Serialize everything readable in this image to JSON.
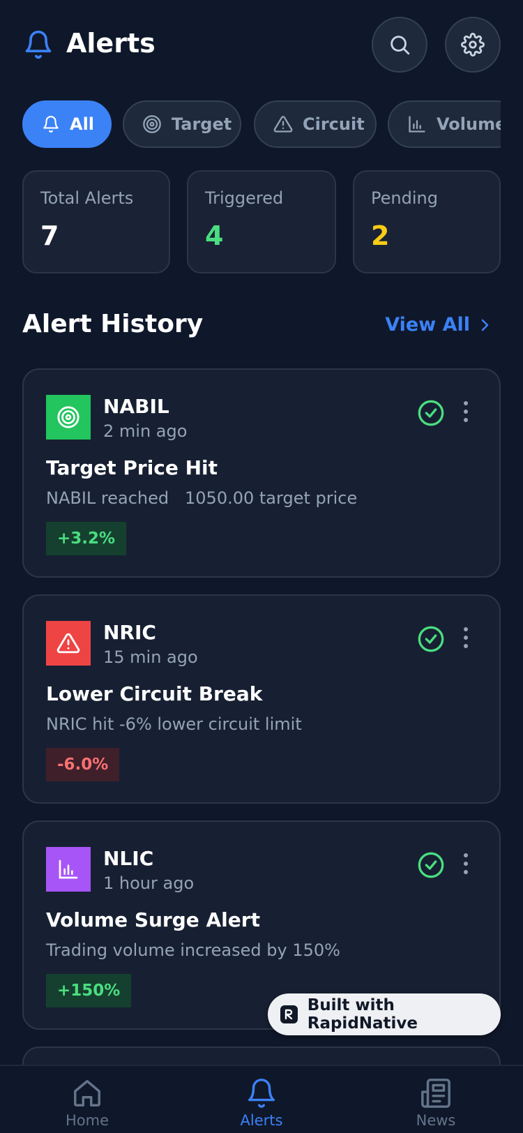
{
  "header": {
    "title": "Alerts",
    "search_icon": "search-icon",
    "settings_icon": "gear-icon"
  },
  "filters": [
    {
      "label": "All",
      "icon": "bell-icon",
      "active": true
    },
    {
      "label": "Target",
      "icon": "target-icon",
      "active": false
    },
    {
      "label": "Circuit",
      "icon": "warning-icon",
      "active": false
    },
    {
      "label": "Volume",
      "icon": "bar-chart-icon",
      "active": false
    }
  ],
  "stats": [
    {
      "label": "Total Alerts",
      "value": "7",
      "color": "#ffffff"
    },
    {
      "label": "Triggered",
      "value": "4",
      "color": "#4ade80"
    },
    {
      "label": "Pending",
      "value": "2",
      "color": "#facc15"
    }
  ],
  "section": {
    "title": "Alert History",
    "view_all": "View All"
  },
  "alerts": [
    {
      "symbol": "NABIL",
      "time": "2 min ago",
      "title": "Target Price Hit",
      "description": "NABIL reached   1050.00 target price",
      "change": "+3.2%",
      "type": "target",
      "icon_color": "#22c55e",
      "trend": "positive"
    },
    {
      "symbol": "NRIC",
      "time": "15 min ago",
      "title": "Lower Circuit Break",
      "description": "NRIC hit -6% lower circuit limit",
      "change": "-6.0%",
      "type": "circuit",
      "icon_color": "#ef4444",
      "trend": "negative"
    },
    {
      "symbol": "NLIC",
      "time": "1 hour ago",
      "title": "Volume Surge Alert",
      "description": "Trading volume increased by 150%",
      "change": "+150%",
      "type": "volume",
      "icon_color": "#a855f7",
      "trend": "positive"
    }
  ],
  "built_with": "Built with RapidNative",
  "bottom_nav": [
    {
      "label": "Home",
      "icon": "home-icon",
      "active": false
    },
    {
      "label": "Alerts",
      "icon": "bell-icon",
      "active": true
    },
    {
      "label": "News",
      "icon": "newspaper-icon",
      "active": false
    }
  ],
  "colors": {
    "background": "#0f172a",
    "accent": "#3b82f6",
    "positive": "#4ade80",
    "negative": "#f87171",
    "pending": "#facc15"
  }
}
